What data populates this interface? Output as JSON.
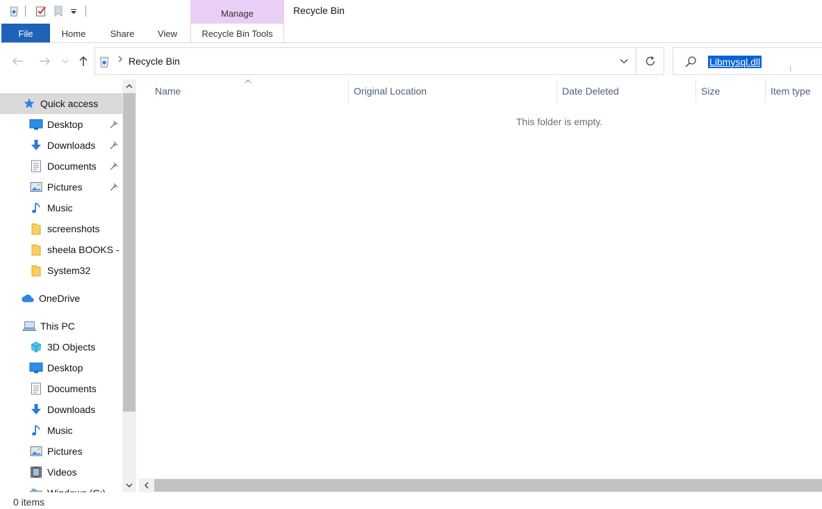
{
  "titlebar": {
    "manage_label": "Manage",
    "window_title": "Recycle Bin"
  },
  "ribbon": {
    "tabs": [
      {
        "label": "File"
      },
      {
        "label": "Home"
      },
      {
        "label": "Share"
      },
      {
        "label": "View"
      },
      {
        "label": "Recycle Bin Tools"
      }
    ]
  },
  "address": {
    "location_icon": "recycle-bin-icon",
    "path": "Recycle Bin"
  },
  "search": {
    "value": "Libmysql.dll"
  },
  "navigation": {
    "items": [
      {
        "label": "Quick access",
        "icon": "star-icon",
        "pinned": false
      },
      {
        "label": "Desktop",
        "icon": "desktop-icon",
        "pinned": true
      },
      {
        "label": "Downloads",
        "icon": "download-icon",
        "pinned": true
      },
      {
        "label": "Documents",
        "icon": "documents-icon",
        "pinned": true
      },
      {
        "label": "Pictures",
        "icon": "pictures-icon",
        "pinned": true
      },
      {
        "label": "Music",
        "icon": "music-icon",
        "pinned": false
      },
      {
        "label": "screenshots",
        "icon": "folder-icon",
        "pinned": false
      },
      {
        "label": "sheela BOOKS -",
        "icon": "folder-icon",
        "pinned": false
      },
      {
        "label": "System32",
        "icon": "folder-icon",
        "pinned": false
      },
      {
        "label": "OneDrive",
        "icon": "cloud-icon",
        "pinned": false
      },
      {
        "label": "This PC",
        "icon": "computer-icon",
        "pinned": false
      },
      {
        "label": "3D Objects",
        "icon": "cube-icon",
        "pinned": false
      },
      {
        "label": "Desktop",
        "icon": "desktop-icon",
        "pinned": false
      },
      {
        "label": "Documents",
        "icon": "documents-icon",
        "pinned": false
      },
      {
        "label": "Downloads",
        "icon": "download-icon",
        "pinned": false
      },
      {
        "label": "Music",
        "icon": "music-icon",
        "pinned": false
      },
      {
        "label": "Pictures",
        "icon": "pictures-icon",
        "pinned": false
      },
      {
        "label": "Videos",
        "icon": "video-icon",
        "pinned": false
      },
      {
        "label": "Windows (C:)",
        "icon": "drive-icon",
        "pinned": false
      }
    ],
    "selected": "Quick access"
  },
  "content": {
    "columns": [
      "Name",
      "Original Location",
      "Date Deleted",
      "Size",
      "Item type"
    ],
    "sorted_column": "Name",
    "empty_message": "This folder is empty."
  },
  "status": {
    "text": "0 items"
  },
  "colors": {
    "accent": "#1e63b7",
    "context_tab": "#e9cff6",
    "selection": "#0a63d6",
    "column_header_text": "#4c607a"
  }
}
